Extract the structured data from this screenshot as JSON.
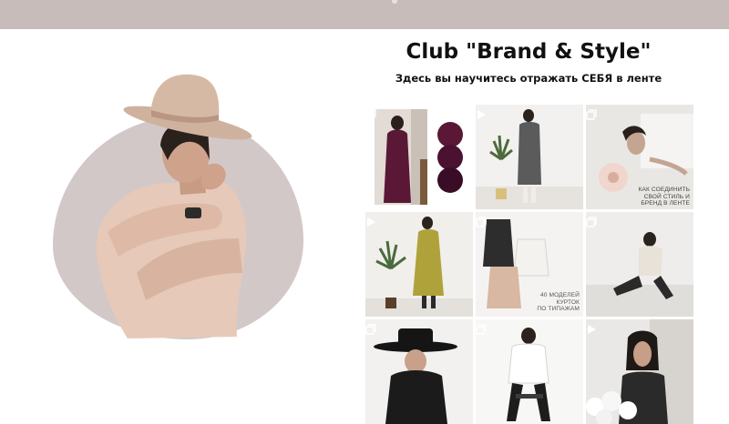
{
  "page": {
    "title": "Club \"Brand & Style\"",
    "subtitle": "Здесь вы научитесь отражать СЕБЯ в ленте"
  },
  "feed": {
    "tiles": [
      {
        "kind": "burgundy-look-palette",
        "badge": "multi-post-icon",
        "colors": [
          "#5a1836",
          "#4a1230",
          "#3a0d26"
        ]
      },
      {
        "kind": "grey-coat-plant",
        "badge": "video-play-icon"
      },
      {
        "kind": "flower-portrait",
        "badge": "multi-post-icon",
        "caption": [
          "КАК СОЕДИНИТЬ",
          "СВОЙ СТИЛЬ И",
          "БРЕНД В ЛЕНТЕ"
        ]
      },
      {
        "kind": "olive-trench",
        "badge": "video-play-icon"
      },
      {
        "kind": "jackets-collage",
        "badge": "multi-post-icon",
        "caption": [
          "40 МОДЕЛЕЙ",
          "КУРТОК",
          "ПО ТИПАЖАМ"
        ]
      },
      {
        "kind": "sitting-pose",
        "badge": "multi-post-icon"
      },
      {
        "kind": "black-hat",
        "badge": "multi-post-icon"
      },
      {
        "kind": "white-shirt-chair",
        "badge": "multi-post-icon"
      },
      {
        "kind": "bob-flowers",
        "badge": "video-play-icon"
      }
    ]
  },
  "colors": {
    "topbar": "#c8bcbb",
    "blob": "#d2c8c8",
    "hat": "#cfb29e",
    "coat": "#e6c9b8",
    "burgundy": "#5a1836",
    "olive": "#b0a23a"
  }
}
